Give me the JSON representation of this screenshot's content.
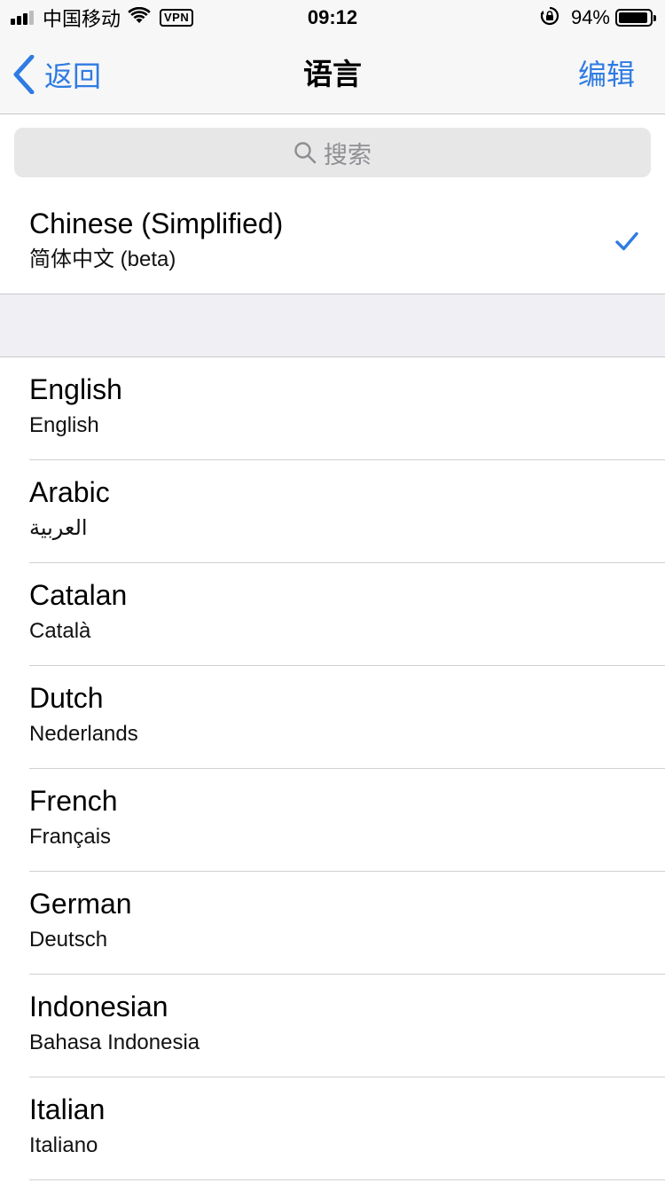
{
  "status_bar": {
    "carrier": "中国移动",
    "vpn": "VPN",
    "time": "09:12",
    "battery_percent": "94%",
    "battery_level": 0.94
  },
  "nav": {
    "back_label": "返回",
    "title": "语言",
    "edit_label": "编辑"
  },
  "search": {
    "placeholder": "搜索"
  },
  "selected_language": {
    "name": "Chinese (Simplified)",
    "native": "简体中文 (beta)",
    "checked": true
  },
  "languages": [
    {
      "name": "English",
      "native": "English"
    },
    {
      "name": "Arabic",
      "native": "العربية"
    },
    {
      "name": "Catalan",
      "native": "Català"
    },
    {
      "name": "Dutch",
      "native": "Nederlands"
    },
    {
      "name": "French",
      "native": "Français"
    },
    {
      "name": "German",
      "native": "Deutsch"
    },
    {
      "name": "Indonesian",
      "native": "Bahasa Indonesia"
    },
    {
      "name": "Italian",
      "native": "Italiano"
    }
  ],
  "colors": {
    "accent": "#2f7be3",
    "bar_bg": "#f7f7f7",
    "section_bg": "#efeff4"
  }
}
